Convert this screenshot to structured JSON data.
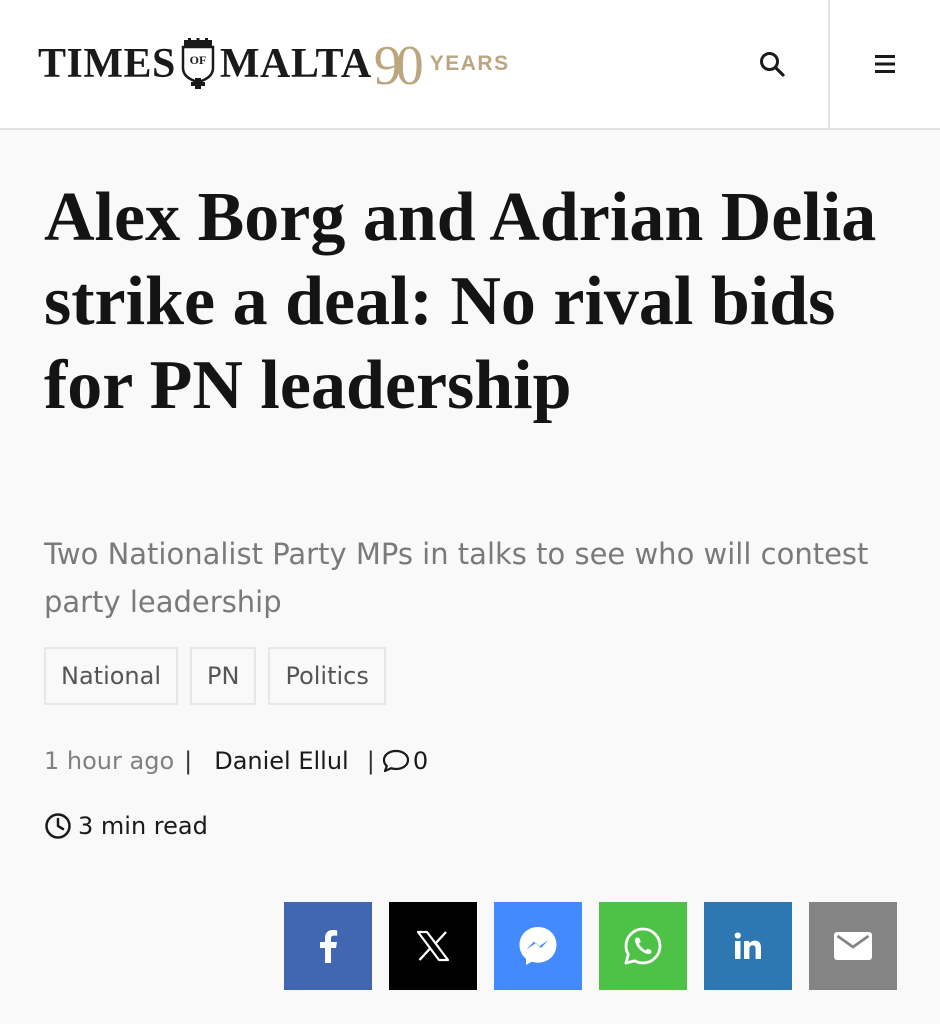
{
  "header": {
    "logo": {
      "word_left": "TIMES",
      "crest_text": "OF",
      "word_right": "MALTA",
      "anniversary_number": "90",
      "anniversary_label": "YEARS"
    },
    "search_icon": "search-icon",
    "menu_icon": "hamburger-menu-icon"
  },
  "article": {
    "headline": "Alex Borg and Adrian Delia strike a deal: No rival bids for PN leadership",
    "subheadline": "Two Nationalist Party MPs in talks to see who will contest party leadership",
    "tags": [
      "National",
      "PN",
      "Politics"
    ],
    "meta": {
      "time": "1 hour ago",
      "separator": "|",
      "author": "Daniel Ellul",
      "comment_count": "0"
    },
    "read_time": "3 min read"
  },
  "share": [
    {
      "name": "facebook",
      "icon": "facebook-icon",
      "color": "#4267b2"
    },
    {
      "name": "x",
      "icon": "x-icon",
      "color": "#000000"
    },
    {
      "name": "messenger",
      "icon": "messenger-icon",
      "color": "#448aff"
    },
    {
      "name": "whatsapp",
      "icon": "whatsapp-icon",
      "color": "#4dc247"
    },
    {
      "name": "linkedin",
      "icon": "linkedin-icon",
      "color": "#2d77b2"
    },
    {
      "name": "email",
      "icon": "email-icon",
      "color": "#848484"
    }
  ],
  "colors": {
    "gold": "#bca680",
    "background": "#f9f9f9",
    "header_bg": "#ffffff"
  }
}
